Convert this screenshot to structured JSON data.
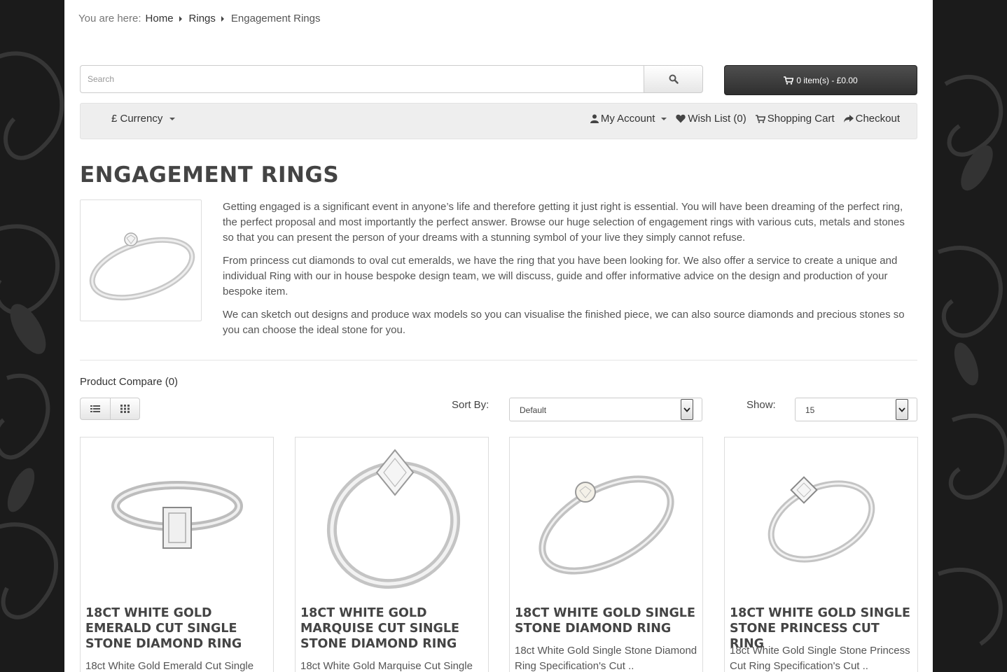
{
  "breadcrumb": {
    "prefix": "You are here:",
    "items": [
      "Home",
      "Rings",
      "Engagement Rings"
    ]
  },
  "search": {
    "placeholder": "Search",
    "icon": "search-icon"
  },
  "cart": {
    "label": "0 item(s) - £0.00",
    "icon": "shopping-cart-icon"
  },
  "topnav": {
    "currency": "£ Currency",
    "my_account": "My Account",
    "wish_list": "Wish List (0)",
    "shopping_cart": "Shopping Cart",
    "checkout": "Checkout"
  },
  "category": {
    "title": "ENGAGEMENT RINGS",
    "paragraphs": [
      "Getting engaged is a significant event in anyone’s life and therefore getting it just right is essential. You will have been dreaming of the perfect ring, the perfect proposal and most importantly the perfect answer. Browse our huge selection of engagement rings with various cuts, metals and stones so that you can present the person of your dreams with a stunning symbol of your live they simply cannot refuse.",
      "From princess cut diamonds to oval cut emeralds, we have the ring that you have been looking for. We also offer a service to create a unique and individual Ring with our in house bespoke design team, we will discuss, guide and offer informative advice on the design and production of your bespoke item.",
      "We can sketch out designs and produce wax models so you can visualise the finished piece, we can also source diamonds and precious stones so you can choose the ideal stone for you."
    ]
  },
  "toolbar": {
    "compare": "Product Compare (0)",
    "sort_label": "Sort By:",
    "sort_value": "Default",
    "show_label": "Show:",
    "show_value": "15"
  },
  "products": [
    {
      "name": "18CT WHITE GOLD EMERALD CUT SINGLE STONE DIAMOND RING",
      "desc": "18ct White Gold Emerald Cut Single"
    },
    {
      "name": "18CT WHITE GOLD MARQUISE CUT SINGLE STONE DIAMOND RING",
      "desc": "18ct White Gold Marquise Cut Single"
    },
    {
      "name": "18CT WHITE GOLD SINGLE STONE DIAMOND RING",
      "desc": "18ct White Gold Single Stone Diamond Ring Specification's Cut .."
    },
    {
      "name": "18CT WHITE GOLD SINGLE STONE PRINCESS CUT RING",
      "desc": "18ct White Gold Single Stone Princess Cut Ring Specification's Cut .."
    }
  ],
  "colors": {
    "page_bg": "#1b1b1b",
    "cart_button": "#3a3a3a",
    "nav_bg": "#eeeeee",
    "title": "#444444"
  }
}
